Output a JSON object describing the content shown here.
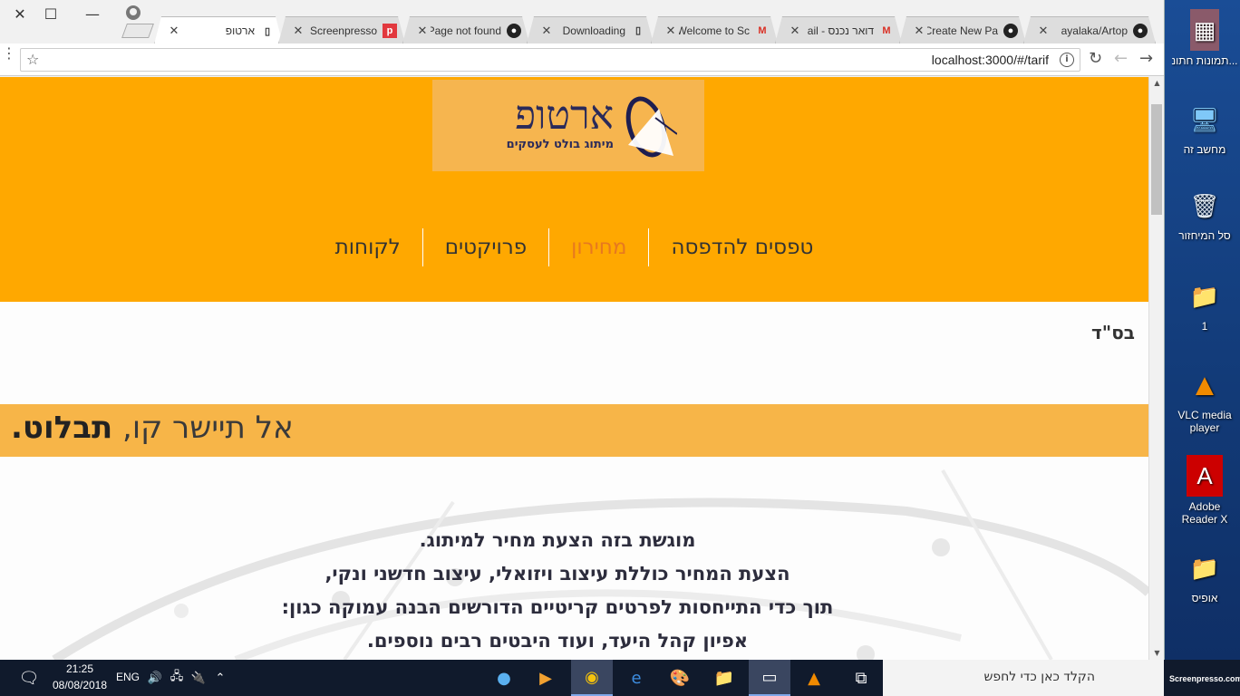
{
  "browser": {
    "tabs": [
      {
        "title": "ארטופ",
        "icon": "page-icon",
        "active": true
      },
      {
        "title": "Screenpresso",
        "icon": "screenpresso-icon"
      },
      {
        "title": "Page not found",
        "icon": "github-icon"
      },
      {
        "title": "Downloading",
        "icon": "page-icon"
      },
      {
        "title": "Welcome to Sc",
        "icon": "gmail-icon"
      },
      {
        "title": "דואר נכנס - ail",
        "icon": "gmail-icon"
      },
      {
        "title": "Create New Pa",
        "icon": "github-icon"
      },
      {
        "title": "ayalaka/Artop",
        "icon": "github-icon"
      }
    ],
    "url": "localhost:3000/#/tarif"
  },
  "page": {
    "logo": {
      "name": "ארטופ",
      "tagline": "מיתוג בולט לעסקים"
    },
    "nav": [
      {
        "label": "טפסים להדפסה",
        "active": false
      },
      {
        "label": "מחירון",
        "active": true
      },
      {
        "label": "פרויקטים",
        "active": false
      },
      {
        "label": "לקוחות",
        "active": false
      }
    ],
    "bsd": "בס\"ד",
    "slogan": {
      "normal": "אל תיישר קו,",
      "bold": "תבלוט."
    },
    "content_lines": [
      "מוגשת בזה הצעת מחיר למיתוג.",
      "הצעת המחיר כוללת עיצוב ויזואלי, עיצוב חדשני ונקי,",
      "תוך כדי התייחסות לפרטים קריטיים הדורשים הבנה עמוקה כגון:",
      "אפיון קהל היעד, ועוד היבטים רבים נוספים."
    ],
    "colors": {
      "header": "#ffa800",
      "nav_active": "#e7791f",
      "slogan_band": "#f7b548"
    }
  },
  "desktop": {
    "icons": [
      {
        "label": "תמונות חתונ...",
        "icon": "folder-photos-icon"
      },
      {
        "label": "מחשב זה",
        "icon": "computer-icon"
      },
      {
        "label": "סל המיחזור",
        "icon": "recycle-bin-icon"
      },
      {
        "label": "1",
        "icon": "user-folder-icon"
      },
      {
        "label": "VLC media player",
        "icon": "vlc-icon"
      },
      {
        "label": "Adobe Reader X",
        "icon": "adobe-reader-icon"
      },
      {
        "label": "אופיס",
        "icon": "office-folder-icon"
      }
    ]
  },
  "taskbar": {
    "time": "21:25",
    "date": "08/08/2018",
    "lang": "ENG",
    "search_placeholder": "הקלד כאן כדי לחפש",
    "screenpresso": "Screenpresso.com"
  }
}
